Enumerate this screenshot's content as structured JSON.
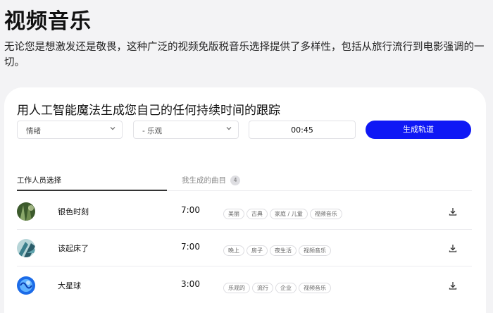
{
  "page": {
    "title": "视频音乐",
    "description": "无论您是想激发还是敬畏，这种广泛的视频免版税音乐选择提供了多样性，包括从旅行流行到电影强调的一切。"
  },
  "generator": {
    "title": "用人工智能魔法生成您自己的任何持续时间的跟踪",
    "mood_value": "情绪",
    "genre_value": "- 乐观",
    "duration_value": "00:45",
    "generate_label": "生成轨道"
  },
  "tabs": [
    {
      "label": "工作人员选择",
      "active": true
    },
    {
      "label": "我生成的曲目",
      "count": "4",
      "active": false
    }
  ],
  "tracks": [
    {
      "name": "银色时刻",
      "duration": "7:00",
      "tags": [
        "美丽",
        "古典",
        "家庭 / 儿童",
        "视频音乐"
      ],
      "thumb_colors": [
        "#3c5a2c",
        "#8aa76a"
      ]
    },
    {
      "name": "该起床了",
      "duration": "7:00",
      "tags": [
        "晚上",
        "房子",
        "夜生活",
        "视频音乐"
      ],
      "thumb_colors": [
        "#3a7f8c",
        "#b7d5d8"
      ]
    },
    {
      "name": "大星球",
      "duration": "3:00",
      "tags": [
        "乐观的",
        "流行",
        "企业",
        "视频音乐"
      ],
      "thumb_colors": [
        "#1b6be8",
        "#5fb2ff"
      ]
    }
  ],
  "icons": {
    "select_chevron": "chevron-down-icon",
    "download": "download-icon"
  },
  "colors": {
    "accent": "#0f18f5",
    "background": "#f3f3f5"
  }
}
